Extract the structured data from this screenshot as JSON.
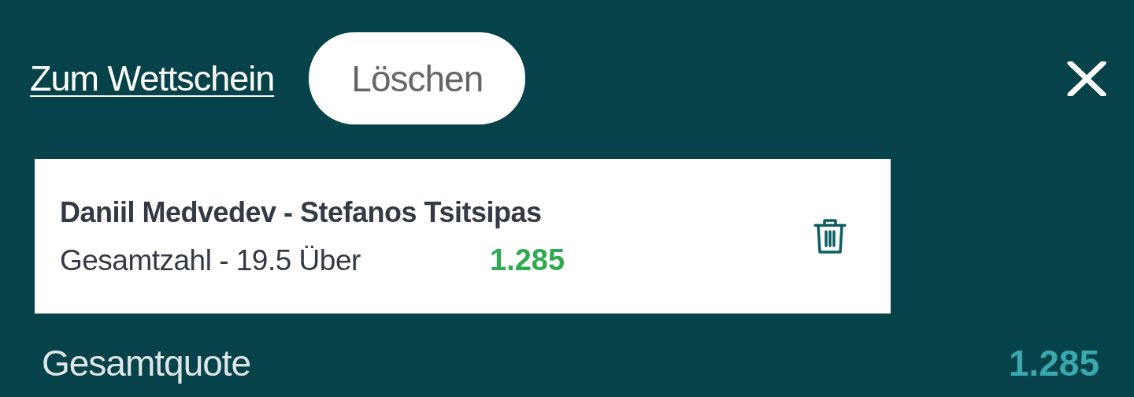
{
  "header": {
    "link": "Zum Wettschein",
    "clear_button": "Löschen"
  },
  "bets": [
    {
      "match": "Daniil Medvedev - Stefanos Tsitsipas",
      "market": "Gesamtzahl - 19.5 Über",
      "odds": "1.285"
    }
  ],
  "total": {
    "label": "Gesamtquote",
    "odds": "1.285"
  }
}
